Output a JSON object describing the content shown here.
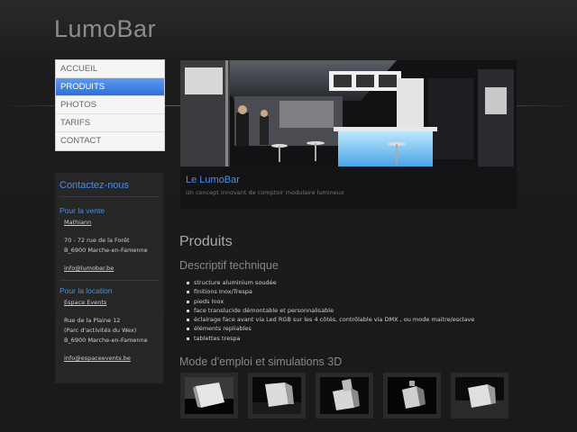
{
  "site": {
    "logo": "LumoBar"
  },
  "nav": {
    "items": [
      {
        "label": "ACCUEIL",
        "active": false
      },
      {
        "label": "PRODUITS",
        "active": true
      },
      {
        "label": "PHOTOS",
        "active": false
      },
      {
        "label": "TARIFS",
        "active": false
      },
      {
        "label": "CONTACT",
        "active": false
      }
    ]
  },
  "contact": {
    "title": "Contactez-nous",
    "sales": {
      "heading": "Pour la vente",
      "name": "Mathiann",
      "address1": "70 - 72 rue de la Forêt",
      "address2": "B_6900 Marche-en-Famenne",
      "email": "info@lumobar.be"
    },
    "rental": {
      "heading": "Pour la location",
      "name": "Espace Events",
      "address1": "Rue de la Plaine 12",
      "address2": "(Parc d'activités du Wex)",
      "address3": "B_6900 Marche-en-Famenne",
      "email": "info@espaceevents.be"
    }
  },
  "hero": {
    "title": "Le LumoBar",
    "subtitle": "Un concept innovant de comptoir modulaire lumineux"
  },
  "content": {
    "heading": "Produits",
    "spec_heading": "Descriptif technique",
    "features": [
      "structure aluminium soudée",
      "finitions Inox/Trespa",
      "pieds Inox",
      "face translucide démontable et personnalisable",
      "éclairage face avant via Led RGB sur les 4 côtés, contrôlable via DMX , ou mode maitre/esclave",
      "éléments repliables",
      "tablettes trespa"
    ],
    "usage_heading": "Mode d'emploi et simulations 3D"
  },
  "colors": {
    "accent": "#4a8ee8",
    "nav_active": "#2f6fd6"
  }
}
